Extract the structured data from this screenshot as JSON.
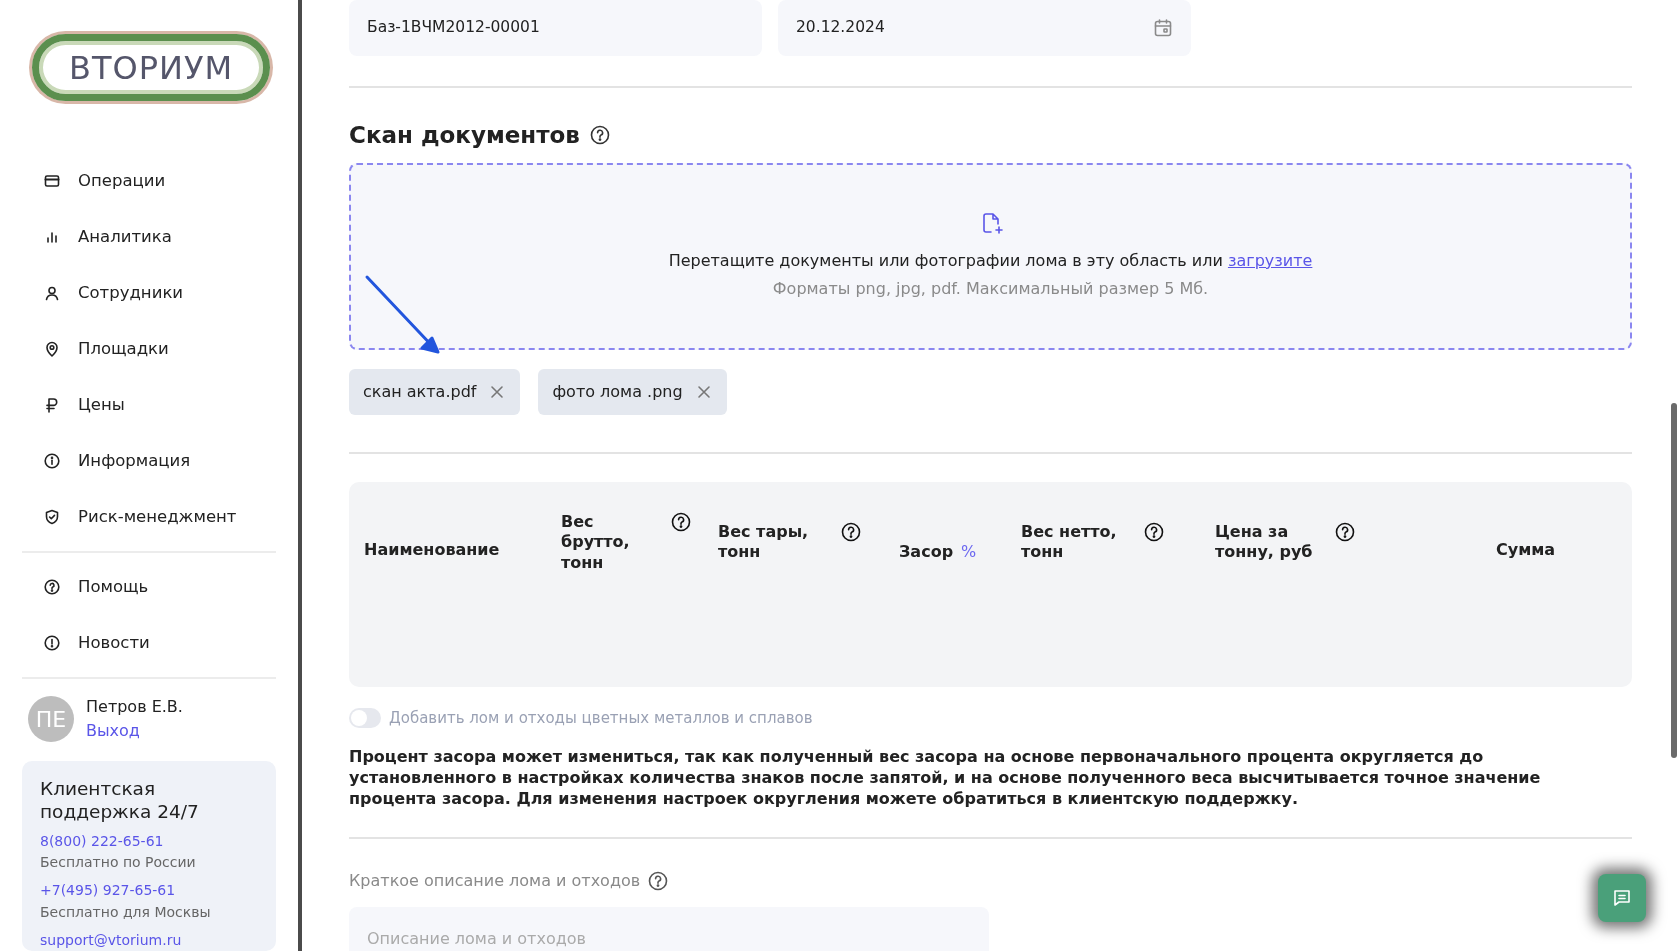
{
  "logo": {
    "text": "ВТОРИУМ"
  },
  "menu": [
    {
      "label": "Операции",
      "kind": "card"
    },
    {
      "label": "Аналитика",
      "kind": "bars"
    },
    {
      "label": "Сотрудники",
      "kind": "user"
    },
    {
      "label": "Площадки",
      "kind": "pin"
    },
    {
      "label": "Цены",
      "kind": "ruble"
    },
    {
      "label": "Информация",
      "kind": "info"
    },
    {
      "label": "Риск-менеджмент",
      "kind": "shield"
    }
  ],
  "menu_secondary": [
    {
      "label": "Помощь",
      "kind": "help"
    },
    {
      "label": "Новости",
      "kind": "alert"
    }
  ],
  "user": {
    "initials": "ПЕ",
    "name": "Петров Е.В.",
    "logout": "Выход"
  },
  "support": {
    "title": "Клиентская поддержка 24/7",
    "contacts": [
      {
        "value": "8(800) 222-65-61",
        "note": "Бесплатно по России"
      },
      {
        "value": "+7(495) 927-65-61",
        "note": "Бесплатно для Москвы"
      },
      {
        "value": "support@vtorium.ru"
      }
    ]
  },
  "fields": [
    {
      "value": "Баз-1ВЧМ2012-00001",
      "kind": "text"
    },
    {
      "value": "20.12.2024",
      "kind": "date"
    }
  ],
  "scan": {
    "title": "Скан документов",
    "drop_text": "Перетащите документы или фотографии лома в эту область или",
    "drop_link": "загрузите",
    "formats": "Форматы png, jpg, pdf. Максимальный размер 5 Мб."
  },
  "files": [
    {
      "name": "скан акта.pdf"
    },
    {
      "name": "фото лома .png"
    }
  ],
  "table": {
    "columns": [
      {
        "label": "Наименование",
        "help": false
      },
      {
        "label": "Вес брутто, тонн",
        "help": true
      },
      {
        "label": "Вес тары, тонн",
        "help": true
      },
      {
        "label": "Засор",
        "unit": "%",
        "help": false
      },
      {
        "label": "Вес нетто, тонн",
        "help": true
      },
      {
        "label": "Цена за тонну, руб",
        "help": true
      },
      {
        "label": "Сумма",
        "help": false
      }
    ]
  },
  "toggle": {
    "label": "Добавить лом и отходы цветных металлов и сплавов",
    "on": false,
    "disabled": true
  },
  "note": "Процент засора может измениться, так как полученный вес засора на основе первоначального процента округляется до установленного в настройках количества знаков после запятой, и на основе полученного веса высчитывается точное значение процента засора. Для изменения настроек округления можете обратиться в клиентскую поддержку.",
  "description": {
    "label": "Краткое описание лома и отходов",
    "placeholder": "Описание лома и отходов"
  }
}
